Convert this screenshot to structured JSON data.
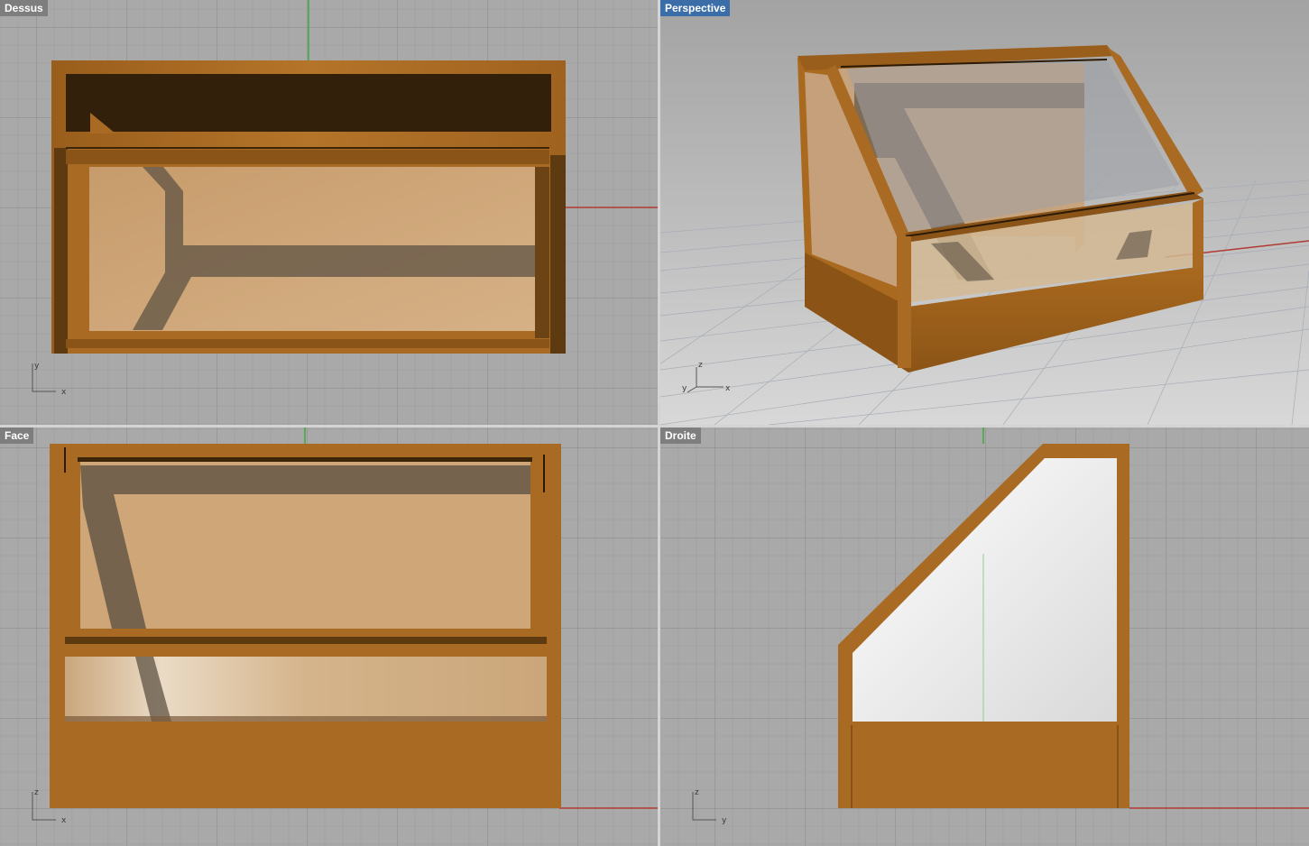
{
  "viewports": {
    "top": {
      "label": "Dessus",
      "axes": {
        "vertical": "y",
        "horizontal": "x"
      }
    },
    "perspective": {
      "label": "Perspective",
      "active": true,
      "axes": {
        "vertical": "z",
        "depth": "y",
        "horizontal": "x"
      }
    },
    "front": {
      "label": "Face",
      "axes": {
        "vertical": "z",
        "horizontal": "x"
      }
    },
    "right": {
      "label": "Droite",
      "axes": {
        "vertical": "z",
        "horizontal": "y"
      }
    }
  },
  "colors": {
    "background": "#a9a9a9",
    "grid_minor": "#9c9c9c",
    "grid_major": "#878787",
    "x_axis": "#b13a32",
    "y_axis": "#3cab3c",
    "wood": "#a96a23",
    "wood_dark": "#5e3a10",
    "panel_light": "#cfa678",
    "active_label": "#3b6ea8",
    "inactive_label": "#7e7e7e"
  },
  "icons": {
    "axis": "axis-triad-icon"
  }
}
